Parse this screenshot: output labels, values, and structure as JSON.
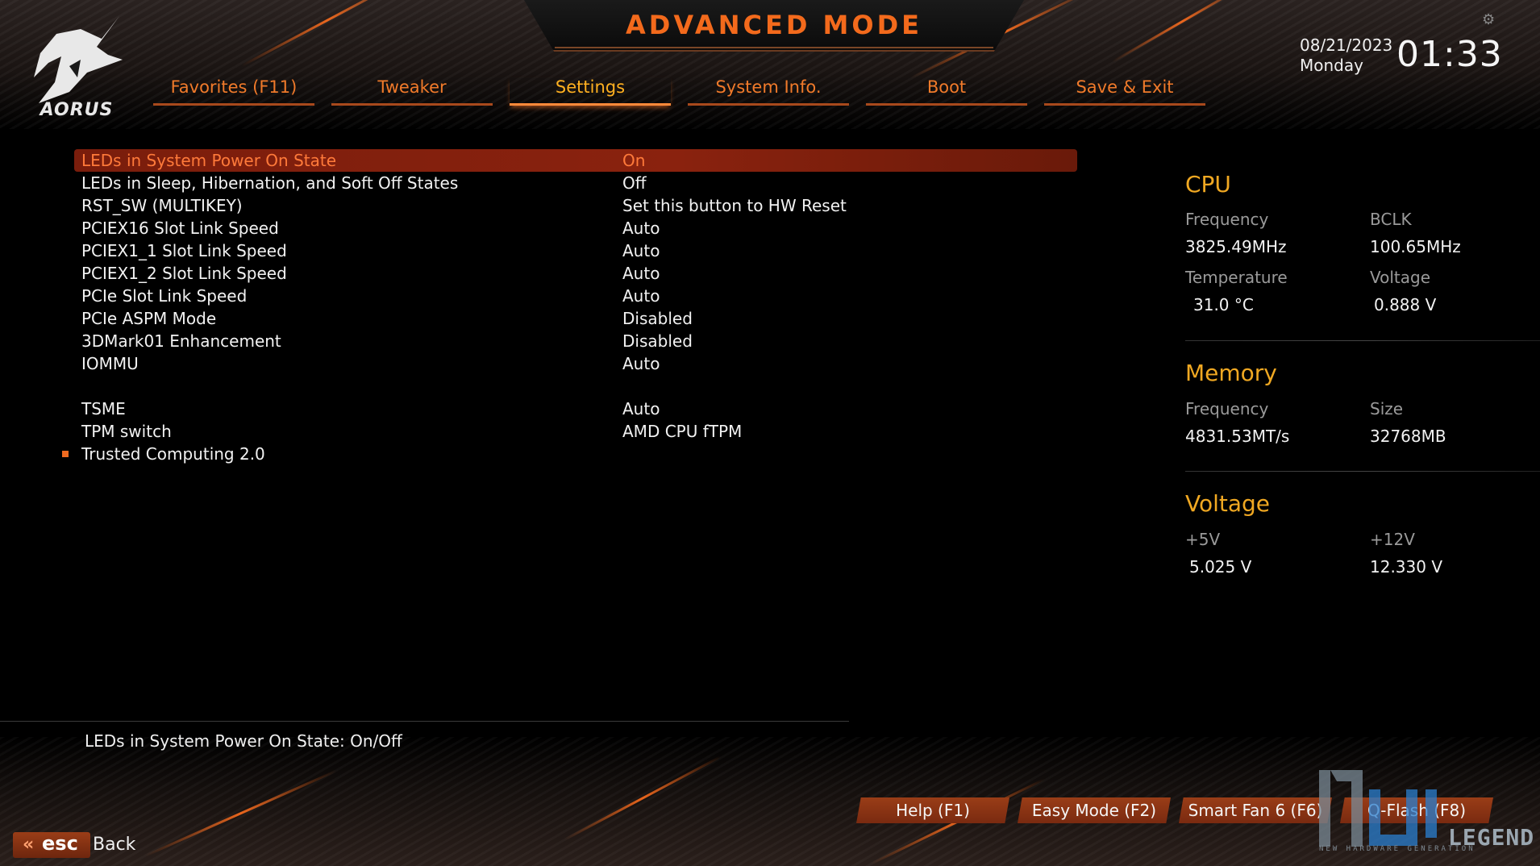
{
  "header": {
    "title": "ADVANCED MODE",
    "logo_text": "AORUS",
    "date": "08/21/2023",
    "day": "Monday",
    "time": "01:33"
  },
  "tabs": [
    {
      "label": "Favorites (F11)",
      "active": false
    },
    {
      "label": "Tweaker",
      "active": false
    },
    {
      "label": "Settings",
      "active": true
    },
    {
      "label": "System Info.",
      "active": false
    },
    {
      "label": "Boot",
      "active": false
    },
    {
      "label": "Save & Exit",
      "active": false
    }
  ],
  "settings": [
    {
      "label": "LEDs in System Power On State",
      "value": "On",
      "selected": true
    },
    {
      "label": "LEDs in Sleep, Hibernation, and Soft Off States",
      "value": "Off"
    },
    {
      "label": "RST_SW (MULTIKEY)",
      "value": "Set this button to HW Reset"
    },
    {
      "label": "PCIEX16 Slot Link Speed",
      "value": "Auto"
    },
    {
      "label": "PCIEX1_1 Slot Link Speed",
      "value": "Auto"
    },
    {
      "label": "PCIEX1_2 Slot Link Speed",
      "value": "Auto"
    },
    {
      "label": "PCIe Slot Link Speed",
      "value": "Auto"
    },
    {
      "label": "PCIe ASPM Mode",
      "value": "Disabled"
    },
    {
      "label": "3DMark01 Enhancement",
      "value": "Disabled"
    },
    {
      "label": "IOMMU",
      "value": "Auto"
    },
    {
      "label": "TSME",
      "value": "Auto"
    },
    {
      "label": "TPM switch",
      "value": "AMD CPU fTPM"
    },
    {
      "label": "Trusted Computing 2.0",
      "value": "",
      "submenu": true
    }
  ],
  "panel": {
    "cpu": {
      "title": "CPU",
      "freq_label": "Frequency",
      "freq": "3825.49MHz",
      "bclk_label": "BCLK",
      "bclk": "100.65MHz",
      "temp_label": "Temperature",
      "temp": "31.0 °C",
      "volt_label": "Voltage",
      "volt": "0.888 V"
    },
    "memory": {
      "title": "Memory",
      "freq_label": "Frequency",
      "freq": "4831.53MT/s",
      "size_label": "Size",
      "size": "32768MB"
    },
    "voltage": {
      "title": "Voltage",
      "v5_label": "+5V",
      "v5": "5.025 V",
      "v12_label": "+12V",
      "v12": "12.330 V"
    }
  },
  "help_text": "LEDs in System Power On State: On/Off",
  "footer": {
    "buttons": [
      "Help (F1)",
      "Easy Mode (F2)",
      "Smart Fan 6 (F6)",
      "Q-Flash (F8)"
    ],
    "esc_label": "esc",
    "back_label": "Back"
  },
  "watermark": {
    "text": "LEGEND",
    "sub": "NEW HARDWARE GENERATION"
  },
  "colors": {
    "accent": "#f36a1c",
    "selected_row": "#8a220e",
    "active_tab": "#ffb020",
    "section_title": "#f0a822"
  }
}
